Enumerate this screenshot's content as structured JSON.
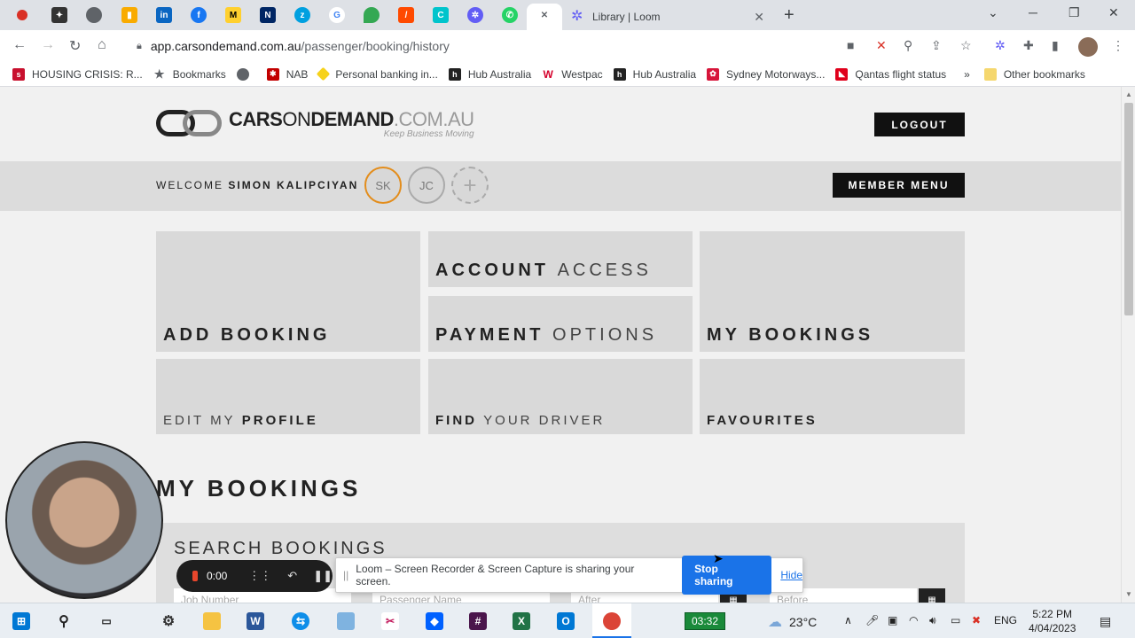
{
  "browser": {
    "active_tab_title": "Library | Loom",
    "url_host": "app.carsondemand.com.au",
    "url_path": "/passenger/booking/history",
    "bookmarks": [
      {
        "label": "HOUSING CRISIS: R...",
        "icon": "sky-news-icon",
        "color": "#c8102e"
      },
      {
        "label": "Bookmarks",
        "icon": "star-icon",
        "color": "#5f6368"
      },
      {
        "label": "",
        "icon": "globe-icon",
        "color": "#5f6368"
      },
      {
        "label": "NAB",
        "icon": "nab-icon",
        "color": "#c20000"
      },
      {
        "label": "Personal banking in...",
        "icon": "commbank-icon",
        "color": "#f6d21b"
      },
      {
        "label": "Hub Australia",
        "icon": "hub-icon",
        "color": "#222222"
      },
      {
        "label": "Westpac",
        "icon": "westpac-icon",
        "color": "#d5002b"
      },
      {
        "label": "Hub Australia",
        "icon": "hub-icon",
        "color": "#222222"
      },
      {
        "label": "Sydney Motorways...",
        "icon": "nsw-icon",
        "color": "#d7153a"
      },
      {
        "label": "Qantas flight status",
        "icon": "qantas-icon",
        "color": "#e0001b"
      }
    ],
    "bookmarks_overflow": "»",
    "other_bookmarks": "Other bookmarks"
  },
  "site": {
    "logo_bold": "CARS",
    "logo_light": "ON",
    "logo_bold2": "DEMAND",
    "logo_grey": ".COM.AU",
    "logo_tagline": "Keep Business Moving",
    "logout_label": "LOGOUT",
    "welcome_prefix": "WELCOME",
    "welcome_name": "SIMON KALIPCIYAN",
    "avatars": [
      "SK",
      "JC",
      "+"
    ],
    "member_menu_label": "MEMBER MENU",
    "tiles": {
      "add_booking": {
        "b": "ADD BOOKING",
        "l": ""
      },
      "account_access": {
        "b": "ACCOUNT",
        "l": "ACCESS"
      },
      "payment_options": {
        "b": "PAYMENT",
        "l": "OPTIONS"
      },
      "my_bookings": {
        "b": "MY BOOKINGS",
        "l": ""
      },
      "edit_profile": {
        "l": "EDIT MY",
        "b": "PROFILE"
      },
      "find_driver": {
        "b": "FIND",
        "l": "YOUR DRIVER"
      },
      "favourites": {
        "b": "FAVOURITES",
        "l": ""
      }
    },
    "section_title": "MY BOOKINGS",
    "search_title": "SEARCH BOOKINGS",
    "search_fields": {
      "job_number": "Job Number",
      "passenger_name": "Passenger Name",
      "after": "After",
      "before": "Before"
    }
  },
  "loom": {
    "timer": "0:00",
    "share_message": "Loom – Screen Recorder & Screen Capture is sharing your screen.",
    "stop_label": "Stop sharing",
    "hide_label": "Hide"
  },
  "taskbar": {
    "timer": "03:32",
    "temperature": "23°C",
    "language": "ENG",
    "time": "5:22 PM",
    "date": "4/04/2023"
  }
}
